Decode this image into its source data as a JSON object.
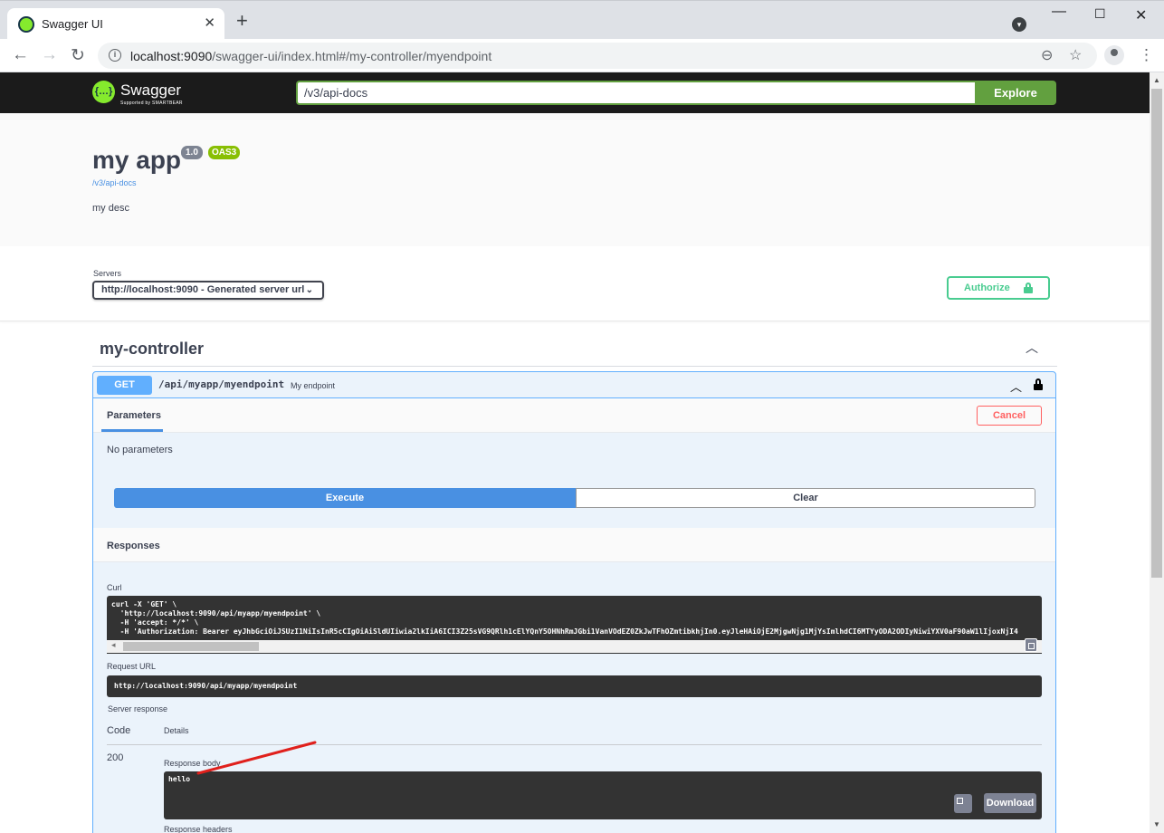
{
  "browser": {
    "tab_title": "Swagger UI",
    "url_host": "localhost:9090",
    "url_path": "/swagger-ui/index.html#/my-controller/myendpoint"
  },
  "topbar": {
    "logo_text": "Swagger",
    "logo_sub": "Supported by SMARTBEAR",
    "url_value": "/v3/api-docs",
    "explore_label": "Explore"
  },
  "info": {
    "title": "my app",
    "version": "1.0",
    "oas_badge": "OAS3",
    "docs_link": "/v3/api-docs",
    "description": "my desc"
  },
  "servers": {
    "label": "Servers",
    "selected": "http://localhost:9090 - Generated server url",
    "authorize_label": "Authorize"
  },
  "tag": {
    "name": "my-controller"
  },
  "operation": {
    "method": "GET",
    "path": "/api/myapp/myendpoint",
    "summary": "My endpoint",
    "parameters_tab": "Parameters",
    "cancel_label": "Cancel",
    "no_params": "No parameters",
    "execute_label": "Execute",
    "clear_label": "Clear",
    "responses_title": "Responses"
  },
  "response": {
    "curl_label": "Curl",
    "curl_lines": [
      "curl -X 'GET' \\",
      "  'http://localhost:9090/api/myapp/myendpoint' \\",
      "  -H 'accept: */*' \\",
      "  -H 'Authorization: Bearer eyJhbGciOiJSUzI1NiIsInR5cCIgOiAiSldUIiwia2lkIiA6ICI3Z25sVG9QRlh1cElYQnY5OHNhRmJGbi1VanVOdEZ0ZkJwTFhOZmtibkhjIn0.eyJleHAiOjE2MjgwNjg1MjYsImlhdCI6MTYyODA2ODIyNiwiYXV0aF90aW1lIjoxNjI4"
    ],
    "request_url_label": "Request URL",
    "request_url": "http://localhost:9090/api/myapp/myendpoint",
    "server_response_label": "Server response",
    "col_code": "Code",
    "col_details": "Details",
    "status_code": "200",
    "body_label": "Response body",
    "body": "hello",
    "download_label": "Download",
    "headers_label": "Response headers"
  },
  "colors": {
    "get_blue": "#61affe",
    "explore_green": "#62a03f",
    "authorize_green": "#49cc90",
    "cancel_red": "#ff6060",
    "execute_blue": "#4990e2"
  }
}
